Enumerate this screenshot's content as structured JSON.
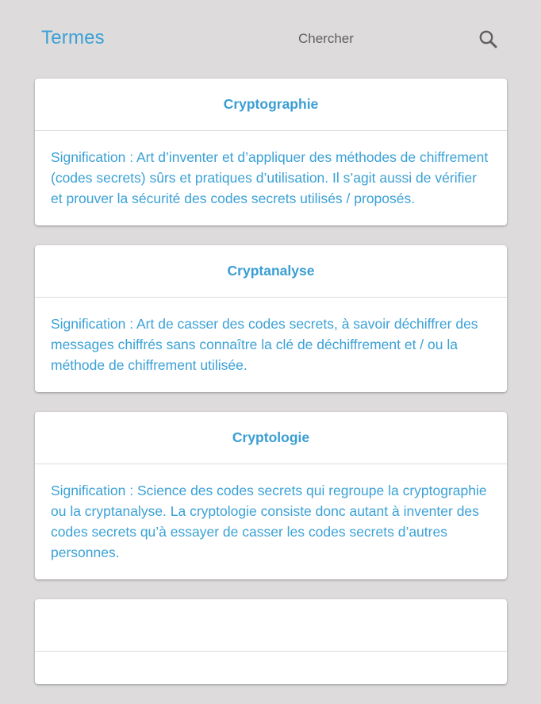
{
  "header": {
    "title": "Termes",
    "search_placeholder": "Chercher",
    "search_icon": "magnifier-icon"
  },
  "colors": {
    "accent": "#3ba1d6",
    "background": "#dddbdc",
    "card": "#ffffff"
  },
  "terms": [
    {
      "title": "Cryptographie",
      "definition": "Signification : Art d’inventer et d’appliquer des méthodes de chiffrement (codes secrets) sûrs et pratiques d’utilisation. Il s’agit aussi de vérifier et prouver la sécurité des codes secrets utilisés / proposés."
    },
    {
      "title": "Cryptanalyse",
      "definition": "Signification : Art de casser des codes secrets, à savoir déchiffrer des messages chiffrés sans connaître la clé de déchiffrement et / ou la méthode de chiffrement utilisée."
    },
    {
      "title": "Cryptologie",
      "definition": "Signification : Science des codes secrets qui regroupe la cryptographie ou la cryptanalyse. La cryptologie consiste donc autant à inventer des codes secrets qu’à essayer de casser les codes secrets d’autres personnes."
    },
    {
      "title": "",
      "definition": ""
    }
  ]
}
